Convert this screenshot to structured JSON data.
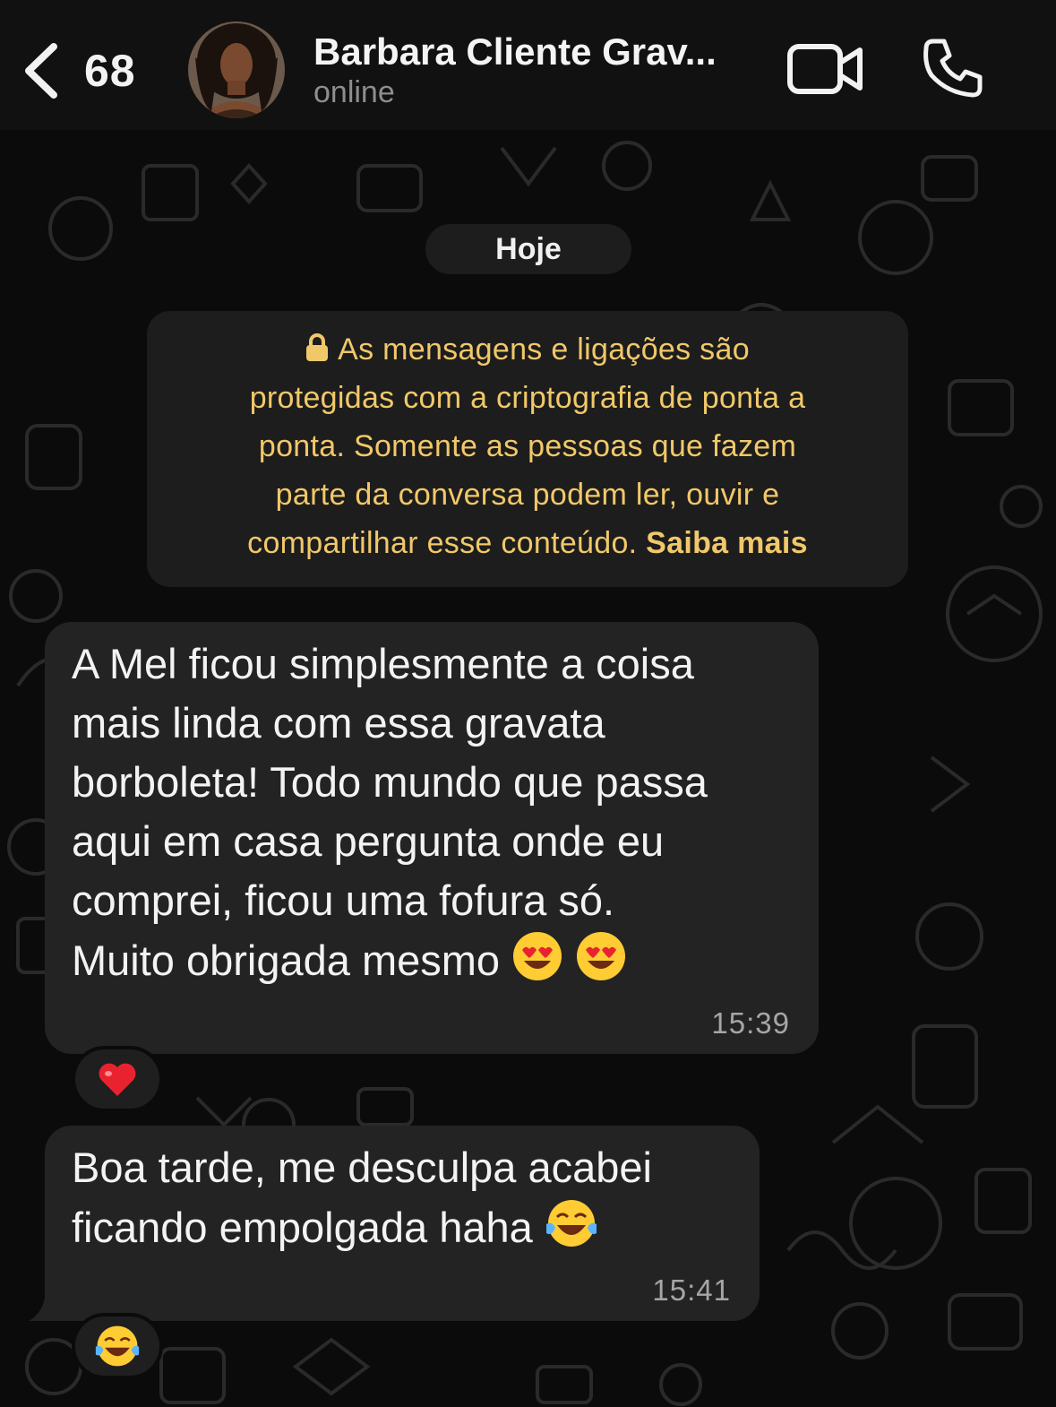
{
  "header": {
    "back_count": "68",
    "contact_name": "Barbara Cliente Grav...",
    "status": "online",
    "icons": [
      "back-chevron-icon",
      "video-call-icon",
      "phone-call-icon"
    ]
  },
  "chat": {
    "date_label": "Hoje",
    "encryption_notice": {
      "lines": [
        "As mensagens e ligações são",
        "protegidas com a criptografia de ponta a",
        "ponta. Somente as pessoas que fazem",
        "parte da conversa podem ler, ouvir e",
        "compartilhar esse conteúdo."
      ],
      "link": "Saiba mais",
      "icon": "lock-icon"
    },
    "messages": [
      {
        "lines": [
          "A Mel ficou simplesmente a coisa",
          "mais linda com essa gravata",
          "borboleta! Todo mundo que passa",
          "aqui em casa pergunta onde eu",
          "comprei, ficou uma fofura só.",
          "Muito obrigada mesmo"
        ],
        "emoji": "heart-eyes-emoji x2",
        "time": "15:39",
        "reaction": "red-heart-emoji"
      },
      {
        "lines": [
          "Boa tarde, me desculpa acabei",
          "ficando empolgada haha"
        ],
        "emoji": "tears-of-joy-emoji",
        "time": "15:41",
        "reaction": "tears-of-joy-emoji"
      }
    ]
  },
  "colors": {
    "header_bg": "#111111",
    "chat_bg": "#0b0b0b",
    "bubble_bg": "#232323",
    "notice_text": "#f1c869",
    "timestamp": "#a6a6a6",
    "status_text": "#8e8e8e"
  }
}
